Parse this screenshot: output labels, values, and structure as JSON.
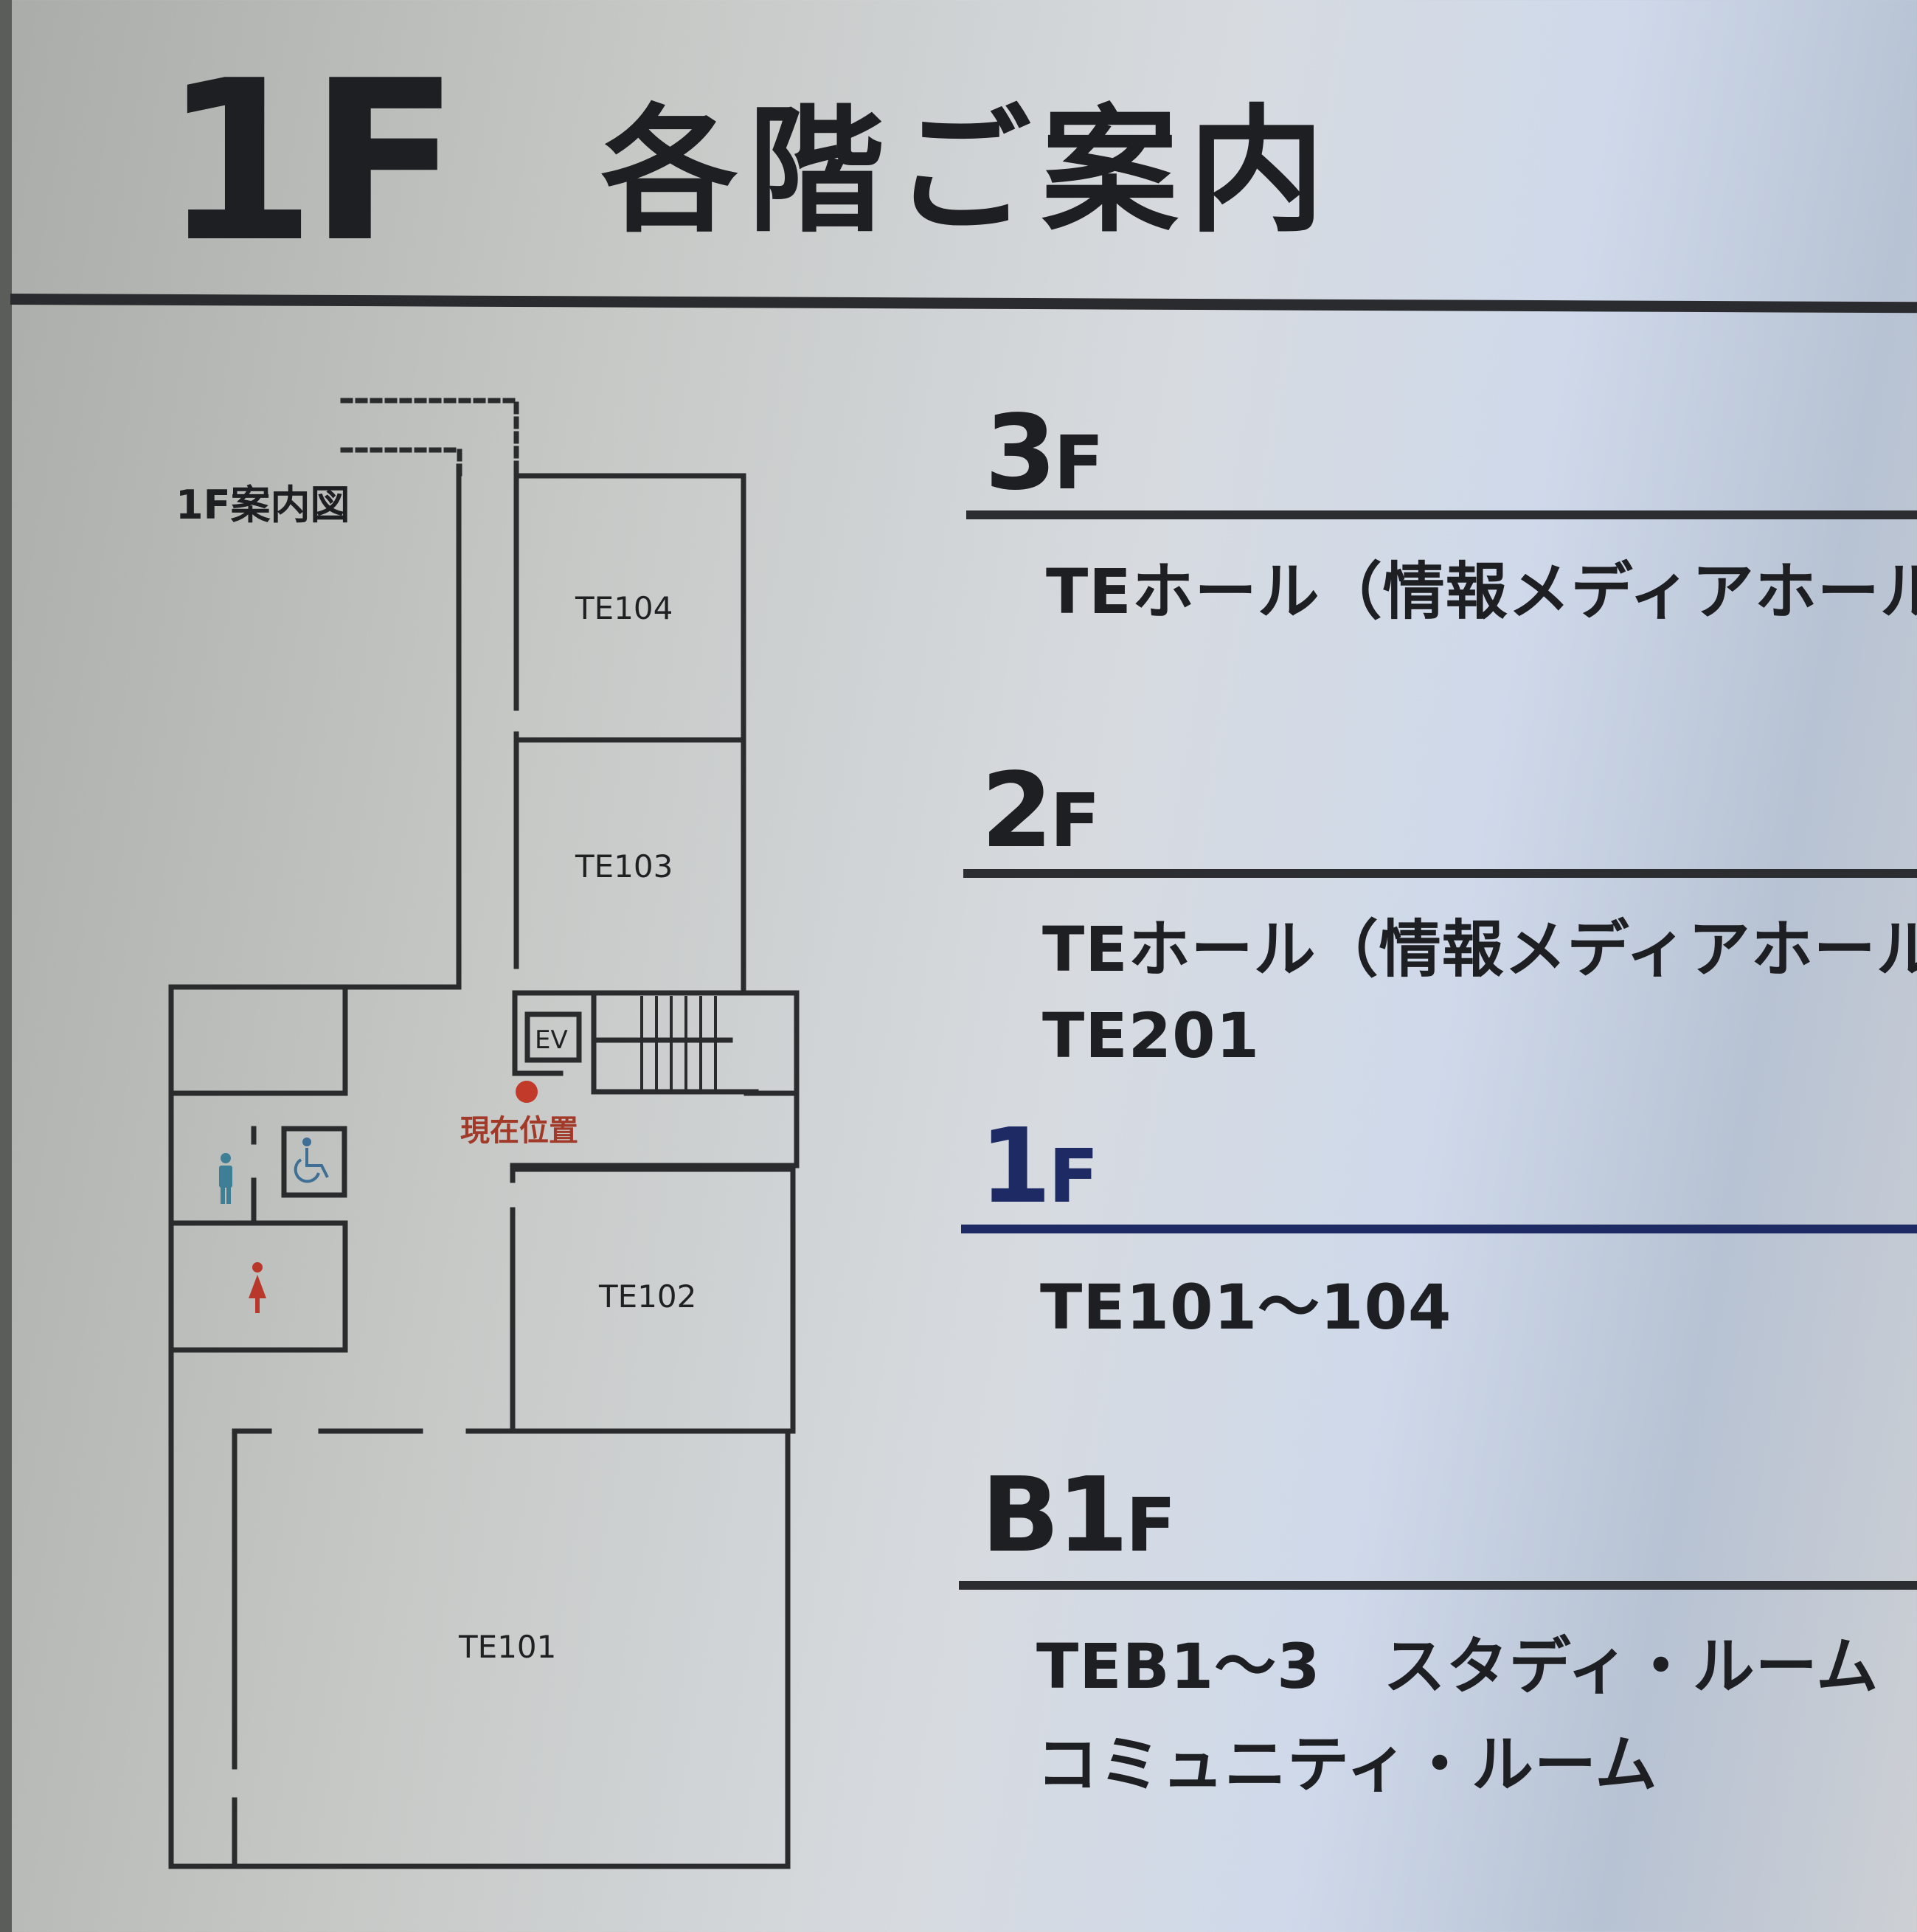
{
  "header": {
    "floor": "1F",
    "title": "各階ご案内"
  },
  "map": {
    "title": "1F案内図",
    "rooms": [
      "TE104",
      "TE103",
      "TE102",
      "TE101"
    ],
    "elevator": "EV",
    "current_location": "現在位置"
  },
  "directory": [
    {
      "floor_num": "3",
      "floor_suffix": "F",
      "items": [
        "TEホール（情報メディアホール）"
      ]
    },
    {
      "floor_num": "2",
      "floor_suffix": "F",
      "items": [
        "TEホール（情報メディアホール）",
        "TE201"
      ]
    },
    {
      "floor_num": "1",
      "floor_suffix": "F",
      "items": [
        "TE101～104"
      ]
    },
    {
      "floor_num": "B1",
      "floor_suffix": "F",
      "items": [
        "TEB1～3　スタディ・ルーム",
        "コミュニティ・ルーム"
      ]
    }
  ],
  "colors": {
    "current_floor": "#1d2a64",
    "current_marker": "#c23a2a",
    "male_icon": "#3f7f96",
    "female_icon": "#b8382b",
    "accessible_icon": "#3f6f95"
  }
}
